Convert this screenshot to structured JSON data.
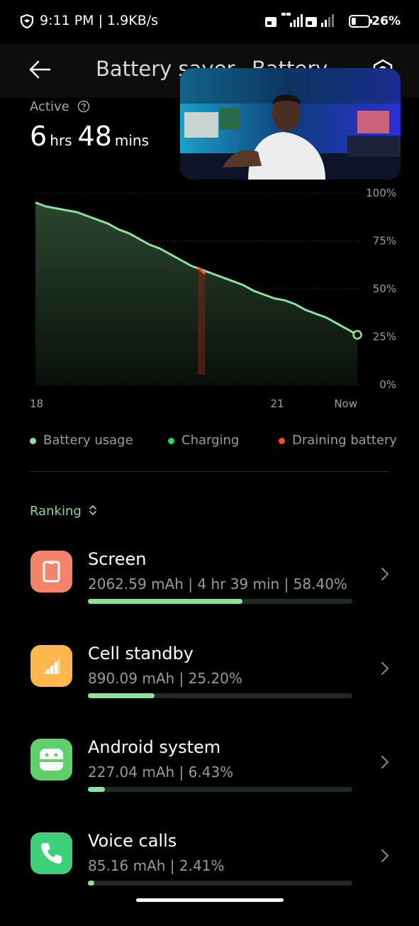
{
  "status_bar": {
    "time": "9:11 PM | 1.9KB/s",
    "battery_percent": "26%",
    "battery_level": 0.26
  },
  "header": {
    "title": "Battery saver",
    "title_partial": "Battery"
  },
  "active": {
    "label": "Active",
    "hours": "6",
    "hours_unit": "hrs",
    "mins": "48",
    "mins_unit": "mins"
  },
  "chart_data": {
    "type": "area",
    "x_ticks": [
      "18",
      "21",
      "Now"
    ],
    "y_ticks": [
      "100%",
      "75%",
      "50%",
      "25%",
      "0%"
    ],
    "ylim": [
      0,
      100
    ],
    "series": [
      {
        "name": "Battery usage",
        "color": "#8fe09c",
        "values": [
          95,
          93,
          92,
          91,
          90,
          88,
          86,
          84,
          81,
          79,
          76,
          73,
          71,
          68,
          65,
          62,
          60,
          58,
          56,
          54,
          52,
          49,
          47,
          45,
          44,
          42,
          39,
          37,
          35,
          32,
          29,
          26
        ]
      }
    ],
    "draining_index": 16
  },
  "legend": [
    {
      "label": "Battery usage",
      "color": "#8fe09c"
    },
    {
      "label": "Charging",
      "color": "#2bd65a"
    },
    {
      "label": "Draining battery",
      "color": "#f4511e"
    }
  ],
  "ranking": {
    "label": "Ranking"
  },
  "items": [
    {
      "name": "Screen",
      "detail": "2062.59 mAh | 4 hr 39 min  | 58.40%",
      "percent": 58.4,
      "color": "#f4836c",
      "icon": "screen-icon"
    },
    {
      "name": "Cell standby",
      "detail": "890.09 mAh | 25.20%",
      "percent": 25.2,
      "color": "#ffb74d",
      "icon": "signal-icon"
    },
    {
      "name": "Android system",
      "detail": "227.04 mAh | 6.43%",
      "percent": 6.43,
      "color": "#5fd06a",
      "icon": "android-icon"
    },
    {
      "name": "Voice calls",
      "detail": "85.16 mAh | 2.41%",
      "percent": 2.41,
      "color": "#3ecf7a",
      "icon": "phone-icon"
    }
  ]
}
